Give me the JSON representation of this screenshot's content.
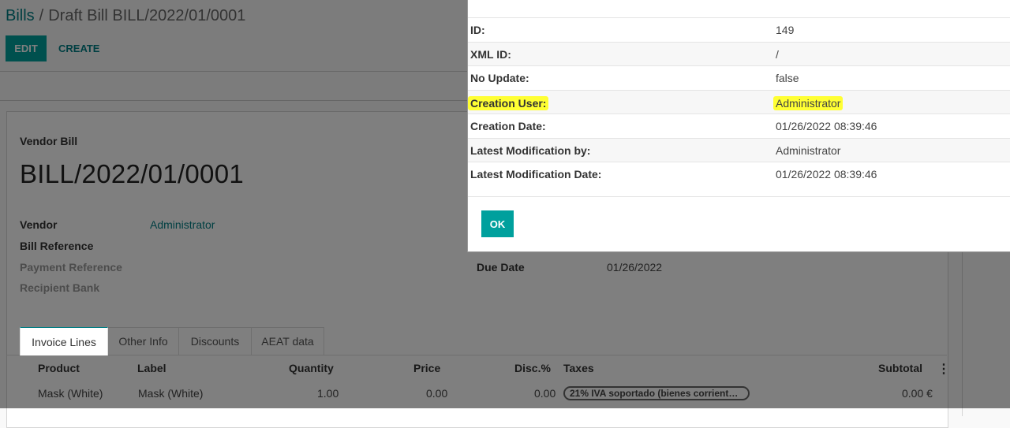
{
  "breadcrumb": {
    "parent": "Bills",
    "separator": "/",
    "current": "Draft Bill BILL/2022/01/0001"
  },
  "toolbar": {
    "edit_label": "EDIT",
    "create_label": "CREATE"
  },
  "form": {
    "doc_type": "Vendor Bill",
    "doc_name": "BILL/2022/01/0001",
    "vendor_label": "Vendor",
    "vendor_value": "Administrator",
    "bill_reference_label": "Bill Reference",
    "payment_reference_label": "Payment Reference",
    "recipient_bank_label": "Recipient Bank",
    "due_date_label": "Due Date",
    "due_date_value": "01/26/2022"
  },
  "tabs": [
    {
      "label": "Invoice Lines",
      "active": true
    },
    {
      "label": "Other Info"
    },
    {
      "label": "Discounts"
    },
    {
      "label": "AEAT data"
    }
  ],
  "table": {
    "headers": [
      "Product",
      "Label",
      "Quantity",
      "Price",
      "Disc.%",
      "Taxes",
      "Subtotal"
    ],
    "rows": [
      {
        "product": "Mask (White)",
        "label": "Mask (White)",
        "quantity": "1.00",
        "price": "0.00",
        "discount": "0.00",
        "taxes": "21% IVA soportado (bienes corrient…",
        "subtotal": "0.00 €"
      }
    ]
  },
  "metadata_dialog": {
    "rows": [
      {
        "key": "ID:",
        "value": "149"
      },
      {
        "key": "XML ID:",
        "value": "/"
      },
      {
        "key": "No Update:",
        "value": "false"
      },
      {
        "key": "Creation User:",
        "value": "Administrator",
        "highlight": true
      },
      {
        "key": "Creation Date:",
        "value": "01/26/2022 08:39:46"
      },
      {
        "key": "Latest Modification by:",
        "value": "Administrator"
      },
      {
        "key": "Latest Modification Date:",
        "value": "01/26/2022 08:39:46"
      }
    ],
    "ok_label": "OK"
  },
  "colors": {
    "primary": "#00a09d",
    "link": "#017e84",
    "highlight": "#ffff33"
  }
}
